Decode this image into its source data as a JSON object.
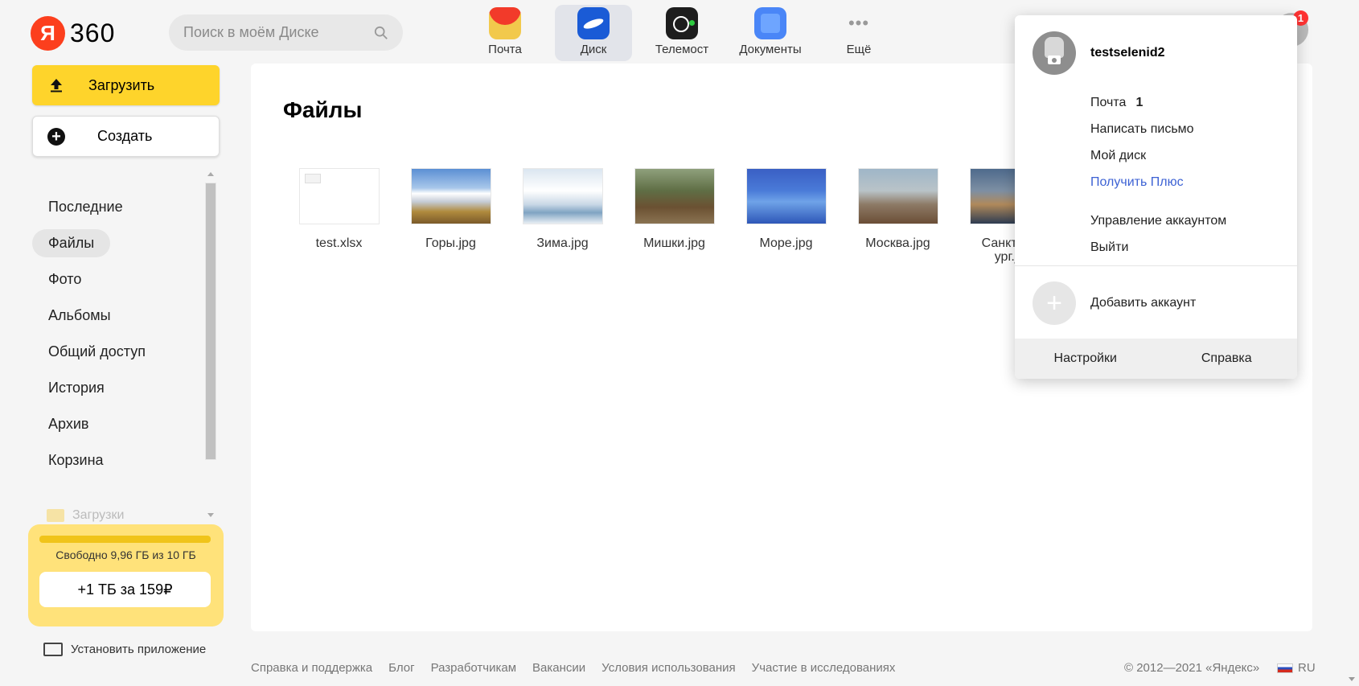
{
  "header": {
    "logo_letter": "Я",
    "logo_text": "360",
    "search_placeholder": "Поиск в моём Диске",
    "apps": [
      {
        "label": "Почта",
        "icon": "mail-icon"
      },
      {
        "label": "Диск",
        "icon": "disk-icon",
        "active": true
      },
      {
        "label": "Телемост",
        "icon": "telemost-icon"
      },
      {
        "label": "Документы",
        "icon": "documents-icon"
      },
      {
        "label": "Ещё",
        "icon": "more-icon"
      }
    ],
    "notification_count": "1"
  },
  "sidebar": {
    "upload_label": "Загрузить",
    "create_label": "Создать",
    "nav": [
      {
        "label": "Последние"
      },
      {
        "label": "Файлы",
        "active": true
      },
      {
        "label": "Фото"
      },
      {
        "label": "Альбомы"
      },
      {
        "label": "Общий доступ"
      },
      {
        "label": "История"
      },
      {
        "label": "Архив"
      },
      {
        "label": "Корзина"
      }
    ],
    "folder_label": "Загрузки",
    "storage_text": "Свободно 9,96 ГБ из 10 ГБ",
    "storage_used_fraction": 0.004,
    "offer_label": "+1 ТБ за 159₽",
    "install_label": "Установить приложение"
  },
  "main": {
    "title": "Файлы",
    "files": [
      {
        "name": "test.xlsx",
        "kind": "spreadsheet"
      },
      {
        "name": "Горы.jpg",
        "kind": "image"
      },
      {
        "name": "Зима.jpg",
        "kind": "image"
      },
      {
        "name": "Мишки.jpg",
        "kind": "image"
      },
      {
        "name": "Море.jpg",
        "kind": "image"
      },
      {
        "name": "Москва.jpg",
        "kind": "image"
      },
      {
        "name_line1": "Санкт-Пе",
        "name_line2": "ург.jp",
        "kind": "image"
      }
    ]
  },
  "footer": {
    "links": [
      "Справка и поддержка",
      "Блог",
      "Разработчикам",
      "Вакансии",
      "Условия использования",
      "Участие в исследованиях"
    ],
    "copyright": "© 2012—2021 «Яндекс»",
    "lang": "RU"
  },
  "account_menu": {
    "username": "testselenid2",
    "mail_label": "Почта",
    "mail_count": "1",
    "write_label": "Написать письмо",
    "disk_label": "Мой диск",
    "plus_label": "Получить Плюс",
    "manage_label": "Управление аккаунтом",
    "logout_label": "Выйти",
    "add_account_label": "Добавить аккаунт",
    "settings_label": "Настройки",
    "help_label": "Справка"
  },
  "colors": {
    "accent_yellow": "#fed42b",
    "brand_red": "#fc3f1d",
    "link_blue": "#3d62d4"
  }
}
